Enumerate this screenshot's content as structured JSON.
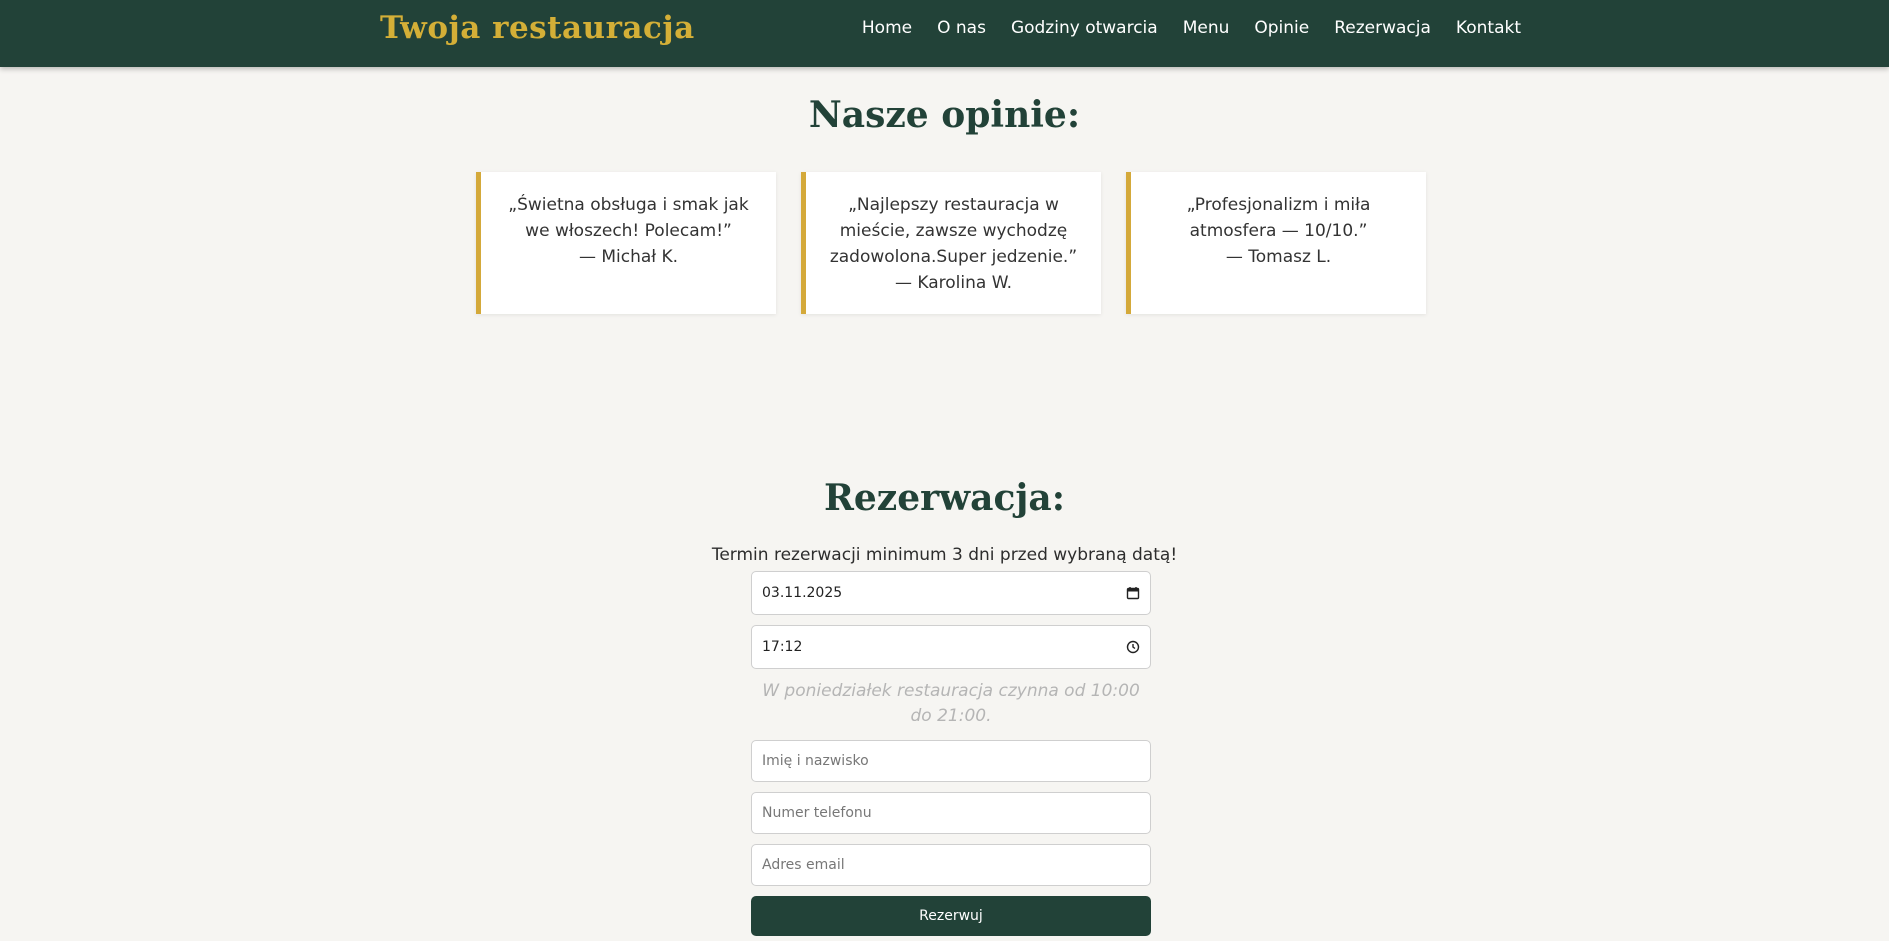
{
  "header": {
    "brand": "Twoja restauracja",
    "nav": [
      "Home",
      "O nas",
      "Godziny otwarcia",
      "Menu",
      "Opinie",
      "Rezerwacja",
      "Kontakt"
    ]
  },
  "reviews": {
    "title": "Nasze opinie:",
    "items": [
      {
        "text": "„Świetna obsługa i smak jak we włoszech! Polecam!”\n— Michał K."
      },
      {
        "text": "„Najlepszy restauracja w mieście, zawsze wychodzę zadowolona.Super jedzenie.”\n— Karolina W."
      },
      {
        "text": "„Profesjonalizm i miła atmosfera — 10/10.”\n— Tomasz L."
      }
    ]
  },
  "reservation": {
    "title": "Rezerwacja:",
    "note": "Termin rezerwacji minimum 3 dni przed wybraną datą!",
    "date_value": "03.11.2025",
    "time_value": "17:12",
    "hours_info": "W poniedziałek restauracja czynna od 10:00 do 21:00.",
    "name_placeholder": "Imię i nazwisko",
    "phone_placeholder": "Numer telefonu",
    "email_placeholder": "Adres email",
    "submit_label": "Rezerwuj"
  },
  "icons": {
    "date": "calendar-icon",
    "time": "clock-icon"
  },
  "colors": {
    "header_bg": "#224238",
    "brand": "#d4af37",
    "card_border": "#d4a93a",
    "page_bg": "#f6f5f2"
  }
}
